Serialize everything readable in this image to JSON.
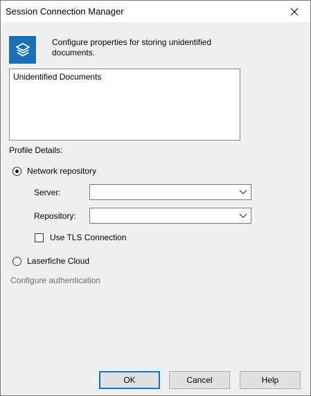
{
  "window": {
    "title": "Session Connection Manager"
  },
  "header": {
    "icon": "layers-stack-icon",
    "description": "Configure properties for storing unidentified documents."
  },
  "profiles_list": {
    "items": [
      "Unidentified Documents"
    ]
  },
  "profile_details": {
    "label": "Profile Details:",
    "network_option": {
      "label": "Network repository",
      "selected": true
    },
    "server": {
      "label": "Server:",
      "value": ""
    },
    "repository": {
      "label": "Repository:",
      "value": ""
    },
    "tls": {
      "label": "Use TLS Connection",
      "checked": false
    },
    "cloud_option": {
      "label": "Laserfiche Cloud",
      "selected": false
    },
    "configure_auth": "Configure authentication"
  },
  "buttons": {
    "ok": "OK",
    "cancel": "Cancel",
    "help": "Help"
  },
  "colors": {
    "accent": "#0078d7",
    "icon_bg": "#1a6fb5",
    "window_bg": "#f0f0f0"
  }
}
